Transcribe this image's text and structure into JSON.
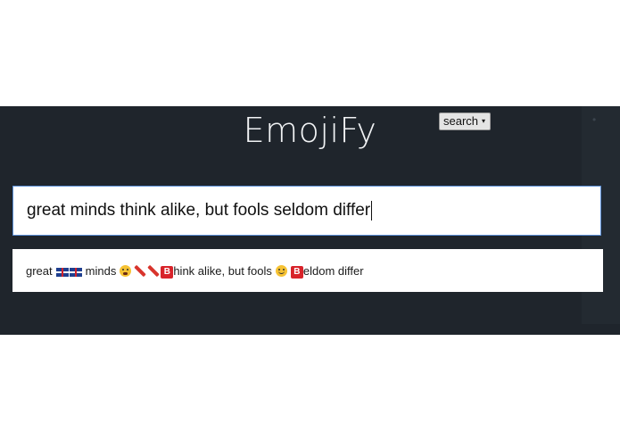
{
  "app": {
    "title": "EmojiFy"
  },
  "mode_select": {
    "selected": "search",
    "caret": "▾"
  },
  "input": {
    "value": "great minds think alike, but fools seldom differ"
  },
  "output": {
    "parts": {
      "w1": "great",
      "w2": "minds",
      "w3": "hink alike, but fools",
      "w4": "eldom differ",
      "b1": "B",
      "b2": "B"
    },
    "icons": [
      "uk-flag-icon",
      "uk-flag-icon",
      "astonished-face-icon",
      "firecracker-icon",
      "firecracker-icon",
      "b-button-icon",
      "upside-down-face-icon",
      "b-button-icon"
    ]
  },
  "colors": {
    "panel_bg": "#1f252c",
    "title_text": "#f1f3f5",
    "input_border": "#5b8fd6",
    "b_button": "#d8232a"
  }
}
